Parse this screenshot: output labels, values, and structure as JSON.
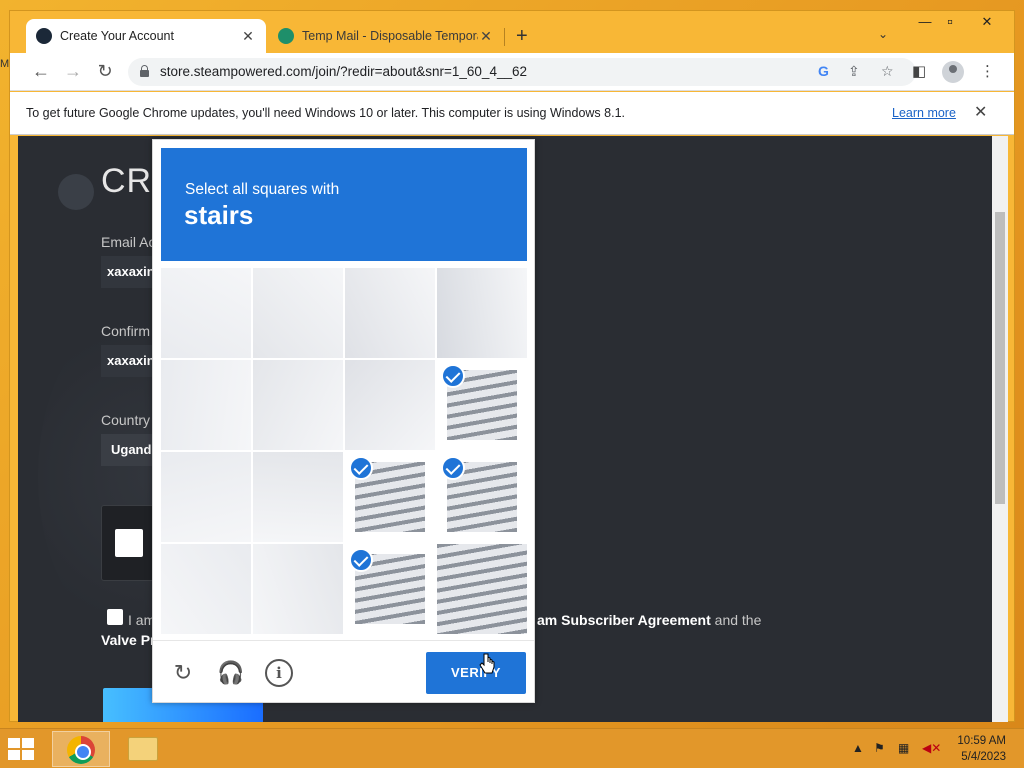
{
  "desktop": {
    "letter": "M"
  },
  "browser": {
    "tabs": [
      {
        "title": "Create Your Account",
        "close": "✕"
      },
      {
        "title": "Temp Mail - Disposable Temporary",
        "close": "✕"
      }
    ],
    "new_tab": "+",
    "tab_list": "⌄",
    "window_controls": {
      "minimize": "—",
      "maximize": "▫",
      "close": "✕"
    },
    "url": "store.steampowered.com/join/?redir=about&snr=1_60_4__62",
    "infobar": {
      "message": "To get future Google Chrome updates, you'll need Windows 10 or later. This computer is using Windows 8.1.",
      "link": "Learn more",
      "close": "✕"
    }
  },
  "page": {
    "title": "CRE",
    "email_label": "Email Ac",
    "email_value": "xaxaxin",
    "confirm_label": "Confirm",
    "confirm_value": "xaxaxin",
    "country_label": "Country",
    "country_value": "Ugand",
    "agree_prefix": "I am",
    "agree_link": "am Subscriber Agreement",
    "agree_suffix": " and the",
    "agree_line2": "Valve Pr"
  },
  "captcha": {
    "prompt": "Select all squares with",
    "target": "stairs",
    "verify_label": "VERIFY",
    "selected_cells": [
      7,
      10,
      11,
      14
    ],
    "accent": "#1f74d7"
  },
  "taskbar": {
    "time": "10:59 AM",
    "date": "5/4/2023"
  }
}
